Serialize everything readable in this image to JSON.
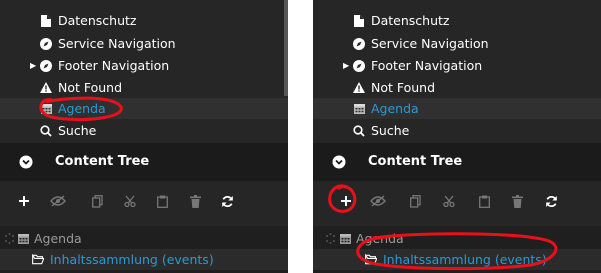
{
  "tree_items": [
    {
      "label": "Datenschutz",
      "icon": "file-icon"
    },
    {
      "label": "Service Navigation",
      "icon": "compass-icon"
    },
    {
      "label": "Footer Navigation",
      "icon": "compass-icon",
      "expandable": true
    },
    {
      "label": "Not Found",
      "icon": "warning-icon"
    },
    {
      "label": "Agenda",
      "icon": "calendar-icon",
      "selected": true
    },
    {
      "label": "Suche",
      "icon": "search-icon"
    }
  ],
  "content_tree": {
    "title": "Content Tree"
  },
  "toolbar": [
    "add",
    "hide",
    "copy",
    "cut",
    "paste",
    "delete",
    "refresh"
  ],
  "content_nodes": [
    {
      "label": "Agenda",
      "icon": "calendar-icon"
    },
    {
      "label": "Inhaltssammlung (events)",
      "icon": "folder-open-icon",
      "selected": true
    }
  ],
  "colors": {
    "accent": "#2a9ad4",
    "annotation": "#e8111b"
  }
}
